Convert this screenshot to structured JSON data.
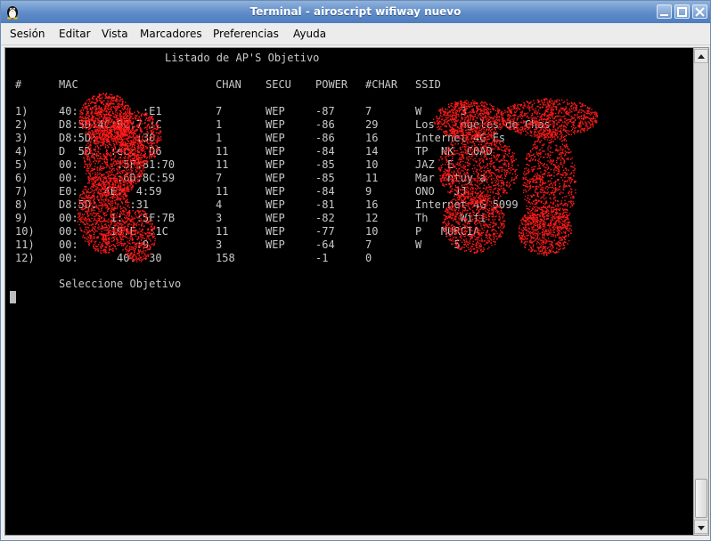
{
  "window": {
    "title": "Terminal - airoscript wifiway nuevo"
  },
  "menu": [
    "Sesión",
    "Editar",
    "Vista",
    "Marcadores",
    "Preferencias",
    "Ayuda"
  ],
  "terminal": {
    "heading": "Listado de AP'S Objetivo",
    "columns": [
      "#",
      "MAC",
      "CHAN",
      "SECU",
      "POWER",
      "#CHAR",
      "SSID"
    ],
    "rows": [
      [
        "1)",
        "40:          :E1",
        "7",
        "WEP",
        "-87",
        "7",
        "W      3"
      ],
      [
        "2)",
        "D8:5D:4C:BC:7 :C",
        "1",
        "WEP",
        "-86",
        "29",
        "Los    ngeles de Chas"
      ],
      [
        "3)",
        "D8:5D:      :30",
        "1",
        "WEP",
        "-86",
        "16",
        "Internet 4G Es"
      ],
      [
        "4)",
        "D  5D:  :ec:  D6",
        "11",
        "WEP",
        "-84",
        "14",
        "TP  NK  C0AD"
      ],
      [
        "5)",
        "00:      :5F:81:70",
        "11",
        "WEP",
        "-85",
        "10",
        "JAZ  E "
      ],
      [
        "6)",
        "00:      :6D:8C:59",
        "7",
        "WEP",
        "-85",
        "11",
        "Mar  ntuy a"
      ],
      [
        "7)",
        "E0:    4E:  4:59",
        "11",
        "WEP",
        "-84",
        "9",
        "ONO   JJ"
      ],
      [
        "8)",
        "D8:5D:     :31",
        "4",
        "WEP",
        "-81",
        "16",
        "Internet 4G 5099"
      ],
      [
        "9)",
        "00:     1:  :5F:7B",
        "3",
        "WEP",
        "-82",
        "12",
        "Th     Wifi"
      ],
      [
        "10)",
        "00:     19:E  :1C",
        "11",
        "WEP",
        "-77",
        "10",
        "P   MURCIA"
      ],
      [
        "11)",
        "00:         :9",
        "3",
        "WEP",
        "-64",
        "7",
        "W     5"
      ],
      [
        "12)",
        "00:      40:  30",
        "158",
        "",
        "-1",
        "0",
        ""
      ]
    ],
    "prompt": "Seleccione Objetivo"
  },
  "colors": {
    "titlebar": "#5e8bc8",
    "terminal_bg": "#000000",
    "terminal_fg": "#c9c9c9",
    "redaction": "#ff1a1a"
  },
  "icons": [
    "tux-icon",
    "minimize-icon",
    "maximize-icon",
    "close-icon",
    "scroll-up-icon",
    "scroll-down-icon"
  ]
}
